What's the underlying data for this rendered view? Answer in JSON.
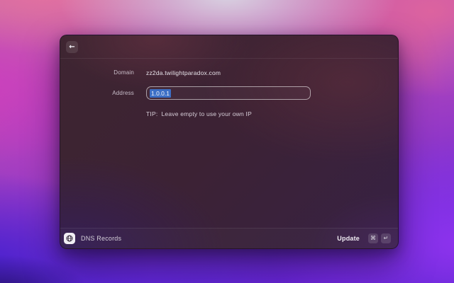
{
  "window": {
    "header": {
      "back_icon": "←"
    },
    "form": {
      "domain_label": "Domain",
      "domain_value": "zz2da.twilightparadox.com",
      "address_label": "Address",
      "address_value": "1.0.0.1",
      "tip": "TIP:  Leave empty to use your own IP"
    },
    "footer": {
      "app_name": "DNS Records",
      "action_label": "Update",
      "keys": [
        "⌘",
        "↵"
      ]
    },
    "colors": {
      "selection_highlight": "#3c6fc6"
    }
  }
}
